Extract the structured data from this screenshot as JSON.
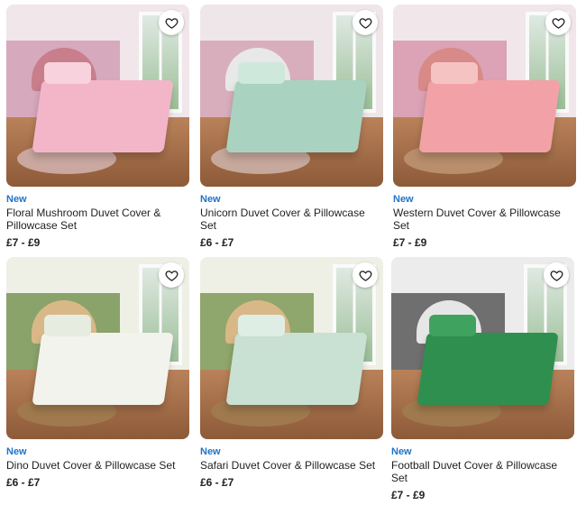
{
  "products": [
    {
      "badge": "New",
      "title": "Floral Mushroom Duvet Cover & Pillowcase Set",
      "price": "£7 - £9",
      "wall": "#f1e6ea",
      "panel": "#d7a9bd",
      "bed": "#f3b6c9",
      "pillow": "#f8d2dc",
      "headboard": "#c97e8c",
      "rug": "#caa8a0",
      "wishlist_icon": "heart-outline-icon"
    },
    {
      "badge": "New",
      "title": "Unicorn Duvet Cover & Pillowcase Set",
      "price": "£6 - £7",
      "wall": "#efe6ea",
      "panel": "#d9aebc",
      "bed": "#a9d3c0",
      "pillow": "#cfe8dc",
      "headboard": "#e8e8e8",
      "rug": "#c7a89c",
      "wishlist_icon": "heart-outline-icon"
    },
    {
      "badge": "New",
      "title": "Western Duvet Cover & Pillowcase Set",
      "price": "£7 - £9",
      "wall": "#f1e7ea",
      "panel": "#dca2b5",
      "bed": "#f2a2a6",
      "pillow": "#f6c3c3",
      "headboard": "#d88a88",
      "rug": "#b98e6c",
      "wishlist_icon": "heart-outline-icon"
    },
    {
      "badge": "New",
      "title": "Dino Duvet Cover & Pillowcase Set",
      "price": "£6 - £7",
      "wall": "#eef0e6",
      "panel": "#8aa36a",
      "bed": "#f3f3ee",
      "pillow": "#e7ece0",
      "headboard": "#d9b887",
      "rug": "#a07a4e",
      "wishlist_icon": "heart-outline-icon"
    },
    {
      "badge": "New",
      "title": "Safari Duvet Cover & Pillowcase Set",
      "price": "£6 - £7",
      "wall": "#eef0e6",
      "panel": "#8fa66c",
      "bed": "#c9e1d3",
      "pillow": "#dfeee4",
      "headboard": "#d9b887",
      "rug": "#a07a4e",
      "wishlist_icon": "heart-outline-icon"
    },
    {
      "badge": "New",
      "title": "Football Duvet Cover & Pillowcase Set",
      "price": "£7 - £9",
      "wall": "#ececec",
      "panel": "#6f6f6f",
      "bed": "#2f8f4e",
      "pillow": "#3fa35f",
      "headboard": "#e6e6e6",
      "rug": "#a07a4e",
      "wishlist_icon": "heart-outline-icon"
    }
  ]
}
